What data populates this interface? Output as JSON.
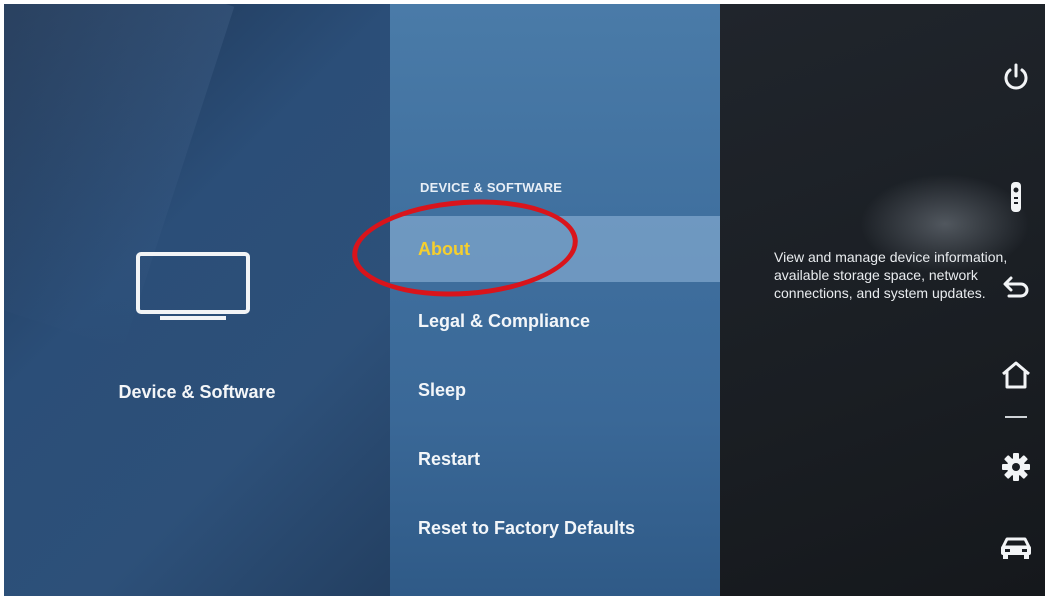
{
  "left": {
    "icon": "tv-icon",
    "label": "Device & Software"
  },
  "menu": {
    "header": "DEVICE & SOFTWARE",
    "items": [
      {
        "label": "About",
        "selected": true
      },
      {
        "label": "Legal & Compliance",
        "selected": false
      },
      {
        "label": "Sleep",
        "selected": false
      },
      {
        "label": "Restart",
        "selected": false
      },
      {
        "label": "Reset to Factory Defaults",
        "selected": false
      }
    ]
  },
  "description": "View and manage device information, available storage space, network connections, and system updates.",
  "side_icons": [
    "power-icon",
    "remote-icon",
    "back-icon",
    "home-icon",
    "settings-icon",
    "car-icon"
  ],
  "colors": {
    "selected_text": "#f5cf2e",
    "highlight_oval": "#d9141b"
  }
}
